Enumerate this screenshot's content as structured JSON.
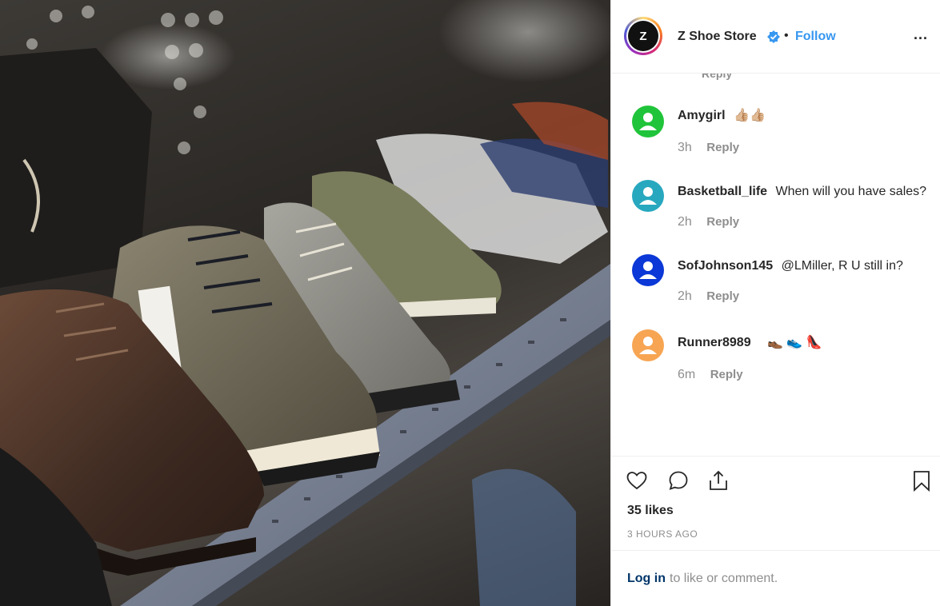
{
  "post": {
    "account_name": "Z Shoe Store",
    "avatar_letter": "Z",
    "separator": "•",
    "follow_label": "Follow",
    "more_label": "...",
    "partial_reply_label": "Reply",
    "comments": [
      {
        "username": "Amygirl",
        "text": "👍🏼👍🏼",
        "time": "3h",
        "reply_label": "Reply",
        "avatar_color": "#20c43a"
      },
      {
        "username": "Basketball_life",
        "text": "When will you have sales?",
        "time": "2h",
        "reply_label": "Reply",
        "avatar_color": "#27a8bf"
      },
      {
        "username": "SofJohnson145",
        "text": "@LMiller, R U still in?",
        "time": "2h",
        "reply_label": "Reply",
        "avatar_color": "#0b38d6"
      },
      {
        "username": "Runner8989",
        "text": "👞 👟 👠",
        "time": "6m",
        "reply_label": "Reply",
        "avatar_color": "#f7a553"
      }
    ],
    "likes_text": "35 likes",
    "time_ago": "3 HOURS AGO",
    "login_link": "Log in",
    "login_rest": "to like or comment."
  },
  "icons": {
    "like": "heart-icon",
    "comment": "comment-icon",
    "share": "share-icon",
    "save": "bookmark-icon",
    "verified": "verified-badge-icon"
  },
  "colors": {
    "follow": "#3897f0",
    "verified": "#3897f0",
    "link": "#003569",
    "muted": "#8e8e8e"
  }
}
